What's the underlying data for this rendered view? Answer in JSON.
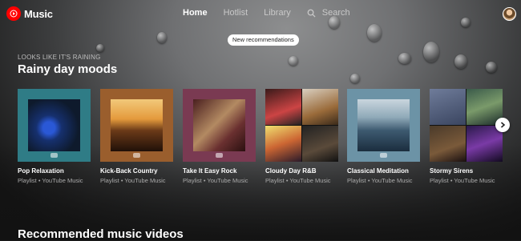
{
  "app": {
    "name": "Music"
  },
  "nav": {
    "items": [
      "Home",
      "Hotlist",
      "Library"
    ],
    "search_label": "Search"
  },
  "banner": {
    "text": "New recommendations"
  },
  "shelf": {
    "eyebrow": "LOOKS LIKE IT'S RAINING",
    "title": "Rainy day moods",
    "cards": [
      {
        "title": "Pop Relaxation",
        "subtitle": "Playlist • YouTube Music"
      },
      {
        "title": "Kick-Back Country",
        "subtitle": "Playlist • YouTube Music"
      },
      {
        "title": "Take It Easy Rock",
        "subtitle": "Playlist • YouTube Music"
      },
      {
        "title": "Cloudy Day R&B",
        "subtitle": "Playlist • YouTube Music"
      },
      {
        "title": "Classical Meditation",
        "subtitle": "Playlist • YouTube Music"
      },
      {
        "title": "Stormy Sirens",
        "subtitle": "Playlist • YouTube Music"
      }
    ]
  },
  "section2": {
    "title": "Recommended music videos"
  },
  "colors": {
    "accent": "#ff0000",
    "text_secondary": "#aaaaaa"
  },
  "icons": [
    "youtube-music-logo-icon",
    "search-icon",
    "avatar",
    "chevron-right-icon"
  ]
}
